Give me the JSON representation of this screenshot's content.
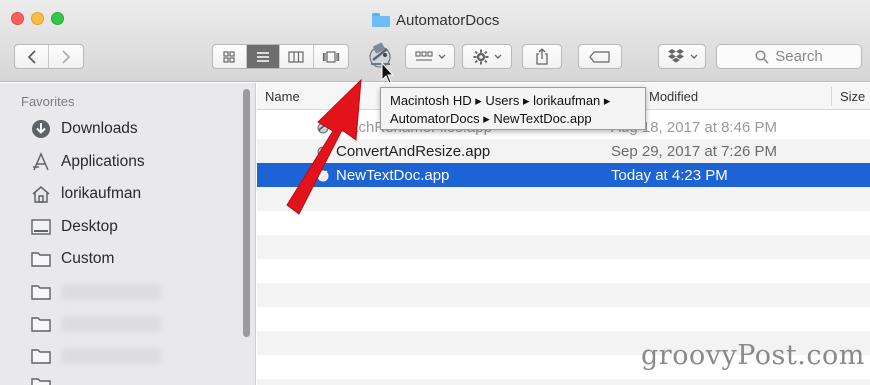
{
  "window": {
    "title": "AutomatorDocs",
    "folder_icon": "folder-icon"
  },
  "toolbar": {
    "back_icon": "chevron-left-icon",
    "forward_icon": "chevron-right-icon",
    "view_modes": [
      "icon-view",
      "list-view",
      "column-view",
      "coverflow-view"
    ],
    "active_view": "list-view",
    "search_placeholder": "Search"
  },
  "sidebar": {
    "section": "Favorites",
    "items": [
      {
        "label": "Downloads",
        "icon": "downloads-icon"
      },
      {
        "label": "Applications",
        "icon": "applications-icon"
      },
      {
        "label": "lorikaufman",
        "icon": "home-icon"
      },
      {
        "label": "Desktop",
        "icon": "desktop-icon"
      },
      {
        "label": "Custom",
        "icon": "folder-icon"
      }
    ]
  },
  "list": {
    "columns": {
      "name": "Name",
      "modified": "Modified",
      "size": "Size"
    },
    "rows": [
      {
        "name": "BatchRenameFiles.app",
        "modified": "Aug 18, 2017 at 8:46 PM"
      },
      {
        "name": "ConvertAndResize.app",
        "modified": "Sep 29, 2017 at 7:26 PM"
      },
      {
        "name": "NewTextDoc.app",
        "modified": "Today at 4:23 PM",
        "selected": true
      }
    ]
  },
  "tooltip": {
    "line1": "Macintosh HD ▸ Users ▸ lorikaufman ▸",
    "line2": "AutomatorDocs ▸ NewTextDoc.app"
  },
  "watermark": "groovyPost.com",
  "colors": {
    "selection": "#1d63d6",
    "arrow": "#e3131b"
  }
}
